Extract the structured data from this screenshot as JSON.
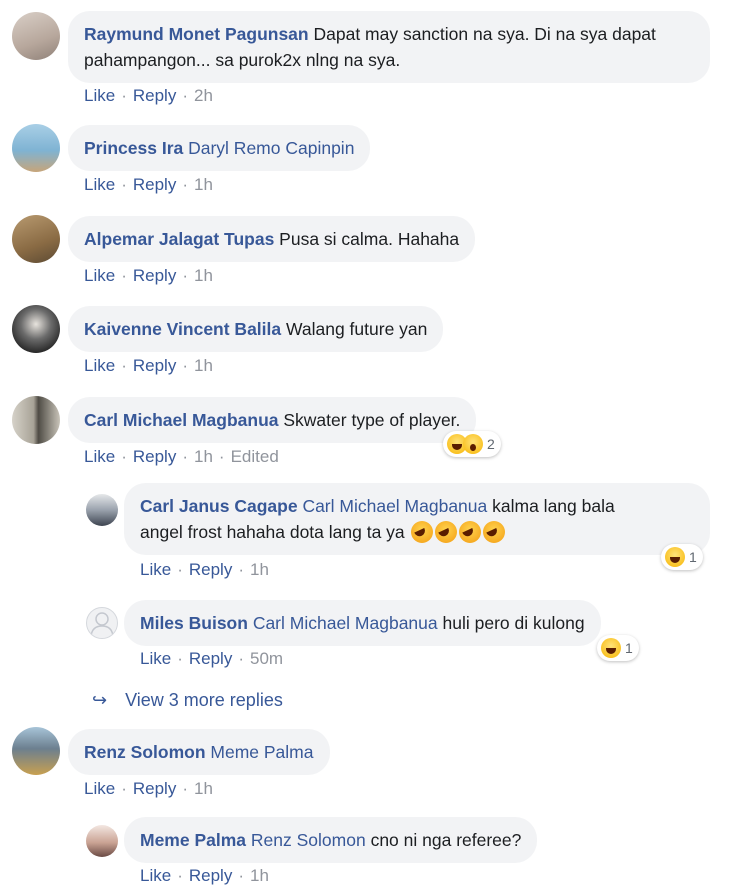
{
  "comments": [
    {
      "name": "Raymund Monet Pagunsan",
      "text": "Dapat may sanction na sya. Di na sya dapat pahampangon... sa purok2x nlng na sya.",
      "like": "Like",
      "reply": "Reply",
      "time": "2h",
      "avatar_color": "#c8b9b0"
    },
    {
      "name": "Princess Ira",
      "mention": "Daryl Remo Capinpin",
      "text": "",
      "like": "Like",
      "reply": "Reply",
      "time": "1h",
      "avatar_color": "#6fa7c8"
    },
    {
      "name": "Alpemar Jalagat Tupas",
      "text": "Pusa si calma. Hahaha",
      "like": "Like",
      "reply": "Reply",
      "time": "1h",
      "avatar_color": "#9c8362"
    },
    {
      "name": "Kaivenne Vincent Balila",
      "text": "Walang future yan",
      "like": "Like",
      "reply": "Reply",
      "time": "1h",
      "avatar_color": "#3a3a3a"
    },
    {
      "name": "Carl Michael Magbanua",
      "text": "Skwater type of player.",
      "like": "Like",
      "reply": "Reply",
      "time": "1h",
      "edited": "Edited",
      "reaction_count": "2",
      "avatar_color": "#b4b0a6"
    }
  ],
  "replies": [
    {
      "name": "Carl Janus Cagape",
      "mention": "Carl Michael Magbanua",
      "text_line1": "kalma lang bala",
      "text_line2": "angel frost hahaha dota lang ta ya",
      "like": "Like",
      "reply": "Reply",
      "time": "1h",
      "reaction_count": "1",
      "avatar_color": "#5a6270"
    },
    {
      "name": "Miles Buison",
      "mention": "Carl Michael Magbanua",
      "text": "huli pero di kulong",
      "like": "Like",
      "reply": "Reply",
      "time": "50m",
      "reaction_count": "1",
      "avatar_color": "#e9ebee"
    }
  ],
  "view_more": "View 3 more replies",
  "comment_renz": {
    "name": "Renz Solomon",
    "mention": "Meme Palma",
    "like": "Like",
    "reply": "Reply",
    "time": "1h",
    "avatar_color": "#7b8fa0"
  },
  "reply_meme": {
    "name": "Meme Palma",
    "mention": "Renz Solomon",
    "text": "cno ni nga referee?",
    "like": "Like",
    "reply": "Reply",
    "time": "1h",
    "avatar_color": "#c9a89b"
  },
  "colors": {
    "link": "#385898",
    "bubble": "#f2f3f5",
    "meta": "#90949c"
  }
}
